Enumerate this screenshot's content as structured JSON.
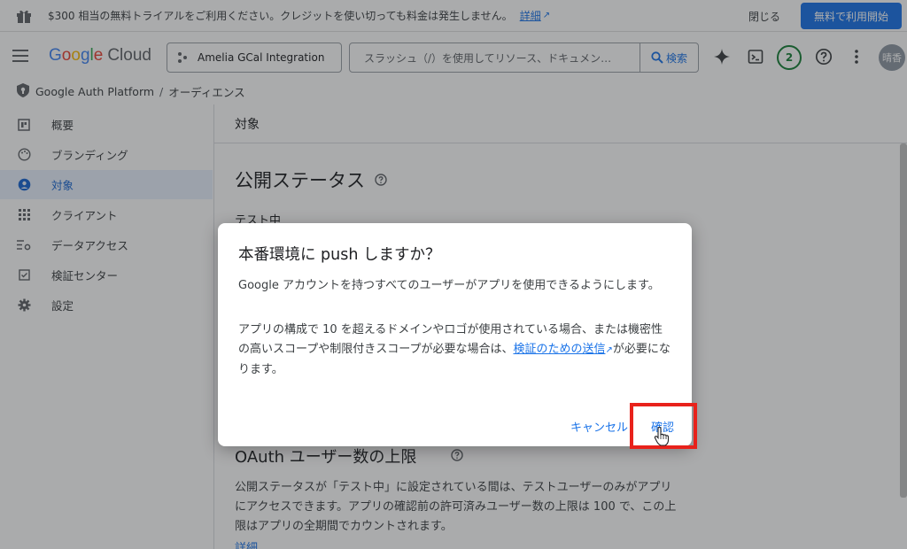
{
  "banner": {
    "message": "$300 相当の無料トライアルをご利用ください。クレジットを使い切っても料金は発生しません。",
    "details_link": "詳細",
    "close_label": "閉じる",
    "trial_button": "無料で利用開始"
  },
  "header": {
    "logo_google": "Google",
    "logo_cloud": "Cloud",
    "project_name": "Amelia GCal Integration",
    "search_placeholder": "スラッシュ（/）を使用してリソース、ドキュメン…",
    "search_button": "検索",
    "notifications_count": "2",
    "avatar_text": "晴香"
  },
  "breadcrumb": {
    "product": "Google Auth Platform",
    "separator": "/",
    "page": "オーディエンス"
  },
  "sidebar": {
    "items": [
      {
        "label": "概要",
        "icon": "dashboard-icon"
      },
      {
        "label": "ブランディング",
        "icon": "palette-icon"
      },
      {
        "label": "対象",
        "icon": "person-icon",
        "active": true
      },
      {
        "label": "クライアント",
        "icon": "grid-icon"
      },
      {
        "label": "データアクセス",
        "icon": "data-settings-icon"
      },
      {
        "label": "検証センター",
        "icon": "checkbox-icon"
      },
      {
        "label": "設定",
        "icon": "gear-icon"
      }
    ]
  },
  "main": {
    "section_title": "対象",
    "publish_status_heading": "公開ステータス",
    "status_value": "テスト中",
    "oauth_limit_heading": "OAuth ユーザー数の上限",
    "oauth_limit_text": "公開ステータスが「テスト中」に設定されている間は、テストユーザーのみがアプリにアクセスできます。アプリの確認前の許可済みユーザー数の上限は 100 で、この上限はアプリの全期間でカウントされます。",
    "more_link": "詳細"
  },
  "dialog": {
    "title": "本番環境に push しますか？",
    "body1": "Google アカウントを持つすべてのユーザーがアプリを使用できるようにします。",
    "body2_prefix": "アプリの構成で 10 を超えるドメインやロゴが使用されている場合、または機密性の高いスコープや制限付きスコープが必要な場合は、",
    "body2_link": "検証のための送信",
    "body2_suffix": "が必要になります。",
    "cancel_label": "キャンセル",
    "confirm_label": "確認"
  },
  "colors": {
    "accent": "#1a73e8",
    "highlight": "#e8221b",
    "active_bg": "#e8f0fe"
  }
}
